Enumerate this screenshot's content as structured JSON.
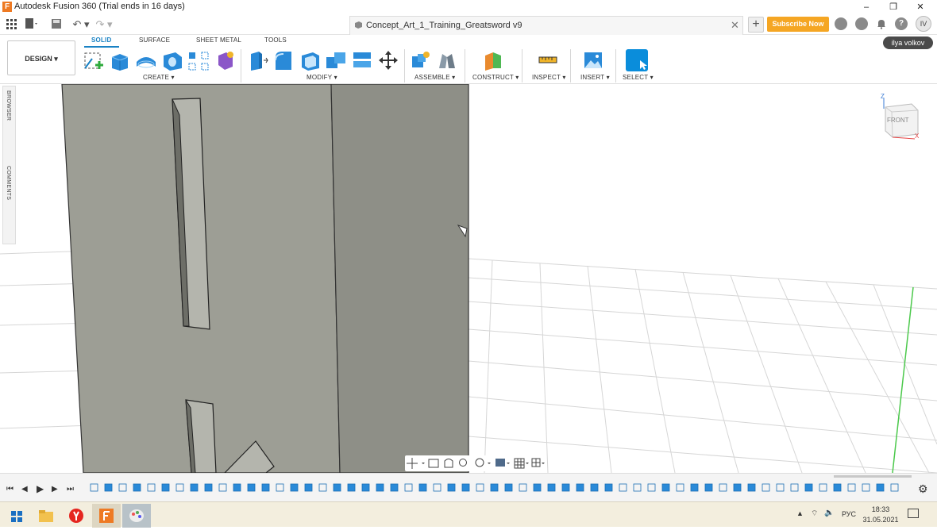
{
  "window": {
    "app_title": "Autodesk Fusion 360 (Trial ends in 16 days)",
    "controls": [
      "–",
      "❐",
      "✕"
    ]
  },
  "quick_access": {
    "undo": "↶ ▾",
    "redo": "↷ ▾"
  },
  "document": {
    "tab_name": "Concept_Art_1_Training_Greatsword v9",
    "close": "✕"
  },
  "header": {
    "new_tab": "+",
    "subscribe_label": "Subscribe Now",
    "help": "?",
    "avatar_initials": "IV",
    "username": "ilya volkov"
  },
  "workspace": {
    "design_label": "DESIGN ▾",
    "tabs": [
      "SOLID",
      "SURFACE",
      "SHEET METAL",
      "TOOLS"
    ],
    "active_tab": "SOLID",
    "groups": [
      {
        "label": "CREATE ▾"
      },
      {
        "label": "MODIFY ▾"
      },
      {
        "label": "ASSEMBLE ▾"
      },
      {
        "label": "CONSTRUCT ▾"
      },
      {
        "label": "INSPECT ▾"
      },
      {
        "label": "INSERT ▾"
      },
      {
        "label": "SELECT ▾"
      }
    ]
  },
  "side_panel": {
    "browser_label": "BROWSER",
    "comments_label": "COMMENTS"
  },
  "viewcube": {
    "face_label": "FRONT",
    "z_axis": "Z",
    "x_axis": "X"
  },
  "colors": {
    "accent_blue": "#1a82c4",
    "subscribe_orange": "#f5a623",
    "body_gray": "#9d9e95",
    "grid_line": "#d6d6d6",
    "green_axis": "#4cc94c"
  },
  "taskbar": {
    "language": "РУС",
    "time": "18:33",
    "date": "31.05.2021"
  }
}
